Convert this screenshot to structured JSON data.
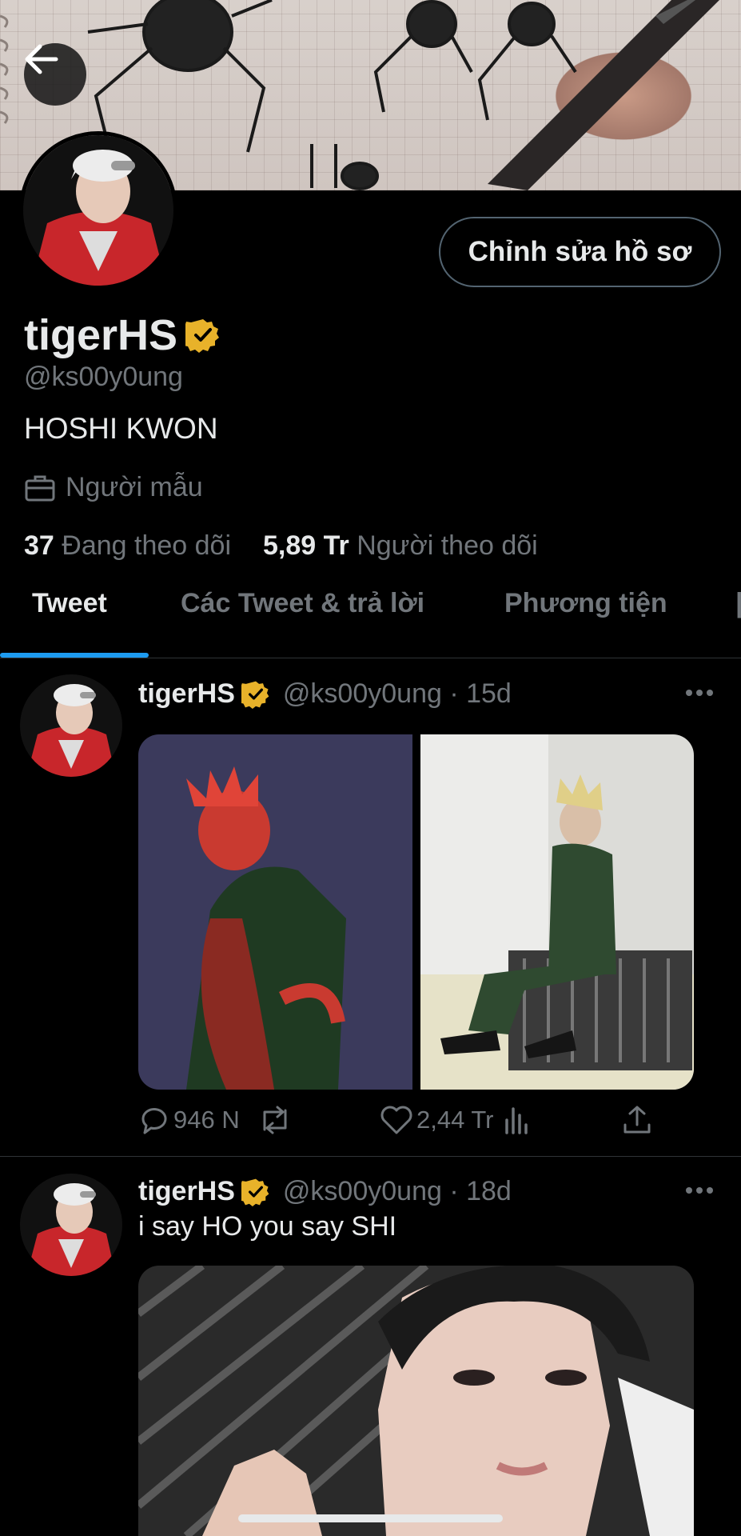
{
  "profile": {
    "display_name": "tigerHS",
    "handle": "@ks00y0ung",
    "bio": "HOSHI KWON",
    "profession": "Người mẫu",
    "following_count": "37",
    "following_label": "Đang theo dõi",
    "followers_count": "5,89 Tr",
    "followers_label": "Người theo dõi",
    "edit_button": "Chỉnh sửa hồ sơ",
    "verified_color": "#e8b22a"
  },
  "tabs": [
    {
      "label": "Tweet",
      "active": true
    },
    {
      "label": "Các Tweet & trả lời",
      "active": false
    },
    {
      "label": "Phương tiện",
      "active": false
    }
  ],
  "tweets": [
    {
      "name": "tigerHS",
      "handle_time": "@ks00y0ung · 15d",
      "text": "",
      "replies": "946 N",
      "retweets": "",
      "likes": "2,44 Tr"
    },
    {
      "name": "tigerHS",
      "handle_time": "@ks00y0ung · 18d",
      "text": "i say HO you say SHI"
    }
  ],
  "colors": {
    "accent": "#1d9bf0",
    "text_primary": "#e7e9ea",
    "text_secondary": "#71767b",
    "background": "#000000"
  },
  "icons": [
    "back-arrow-icon",
    "verified-badge-icon",
    "briefcase-icon",
    "more-icon",
    "reply-icon",
    "retweet-icon",
    "like-icon",
    "views-icon",
    "share-icon"
  ]
}
